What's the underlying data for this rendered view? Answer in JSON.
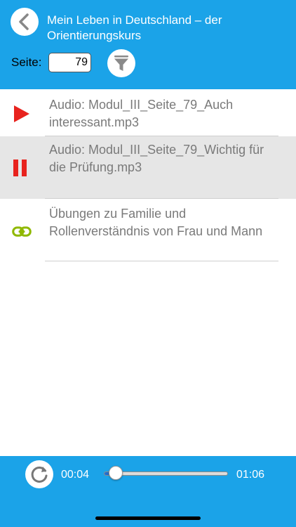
{
  "header": {
    "title_line1": "Mein Leben in Deutschland – der",
    "title_line2": "Orientierungskurs",
    "page_label": "Seite:",
    "page_value": "79"
  },
  "list": {
    "items": [
      {
        "icon": "play-icon",
        "text": "Audio: Modul_III_Seite_79_Auch interessant.mp3",
        "selected": false
      },
      {
        "icon": "pause-icon",
        "text": "Audio: Modul_III_Seite_79_Wichtig für die Prüfung.mp3",
        "selected": true
      },
      {
        "icon": "link-icon",
        "text": "Übungen zu Familie und Rollenverständnis von Frau und Mann",
        "selected": false
      }
    ]
  },
  "player": {
    "current_time": "00:04",
    "total_time": "01:06",
    "progress": 0.06
  },
  "colors": {
    "header_bg": "#1ba3e8",
    "play_red": "#e8231e",
    "link_green": "#8fb800",
    "selected_row": "#e6e6e6"
  }
}
